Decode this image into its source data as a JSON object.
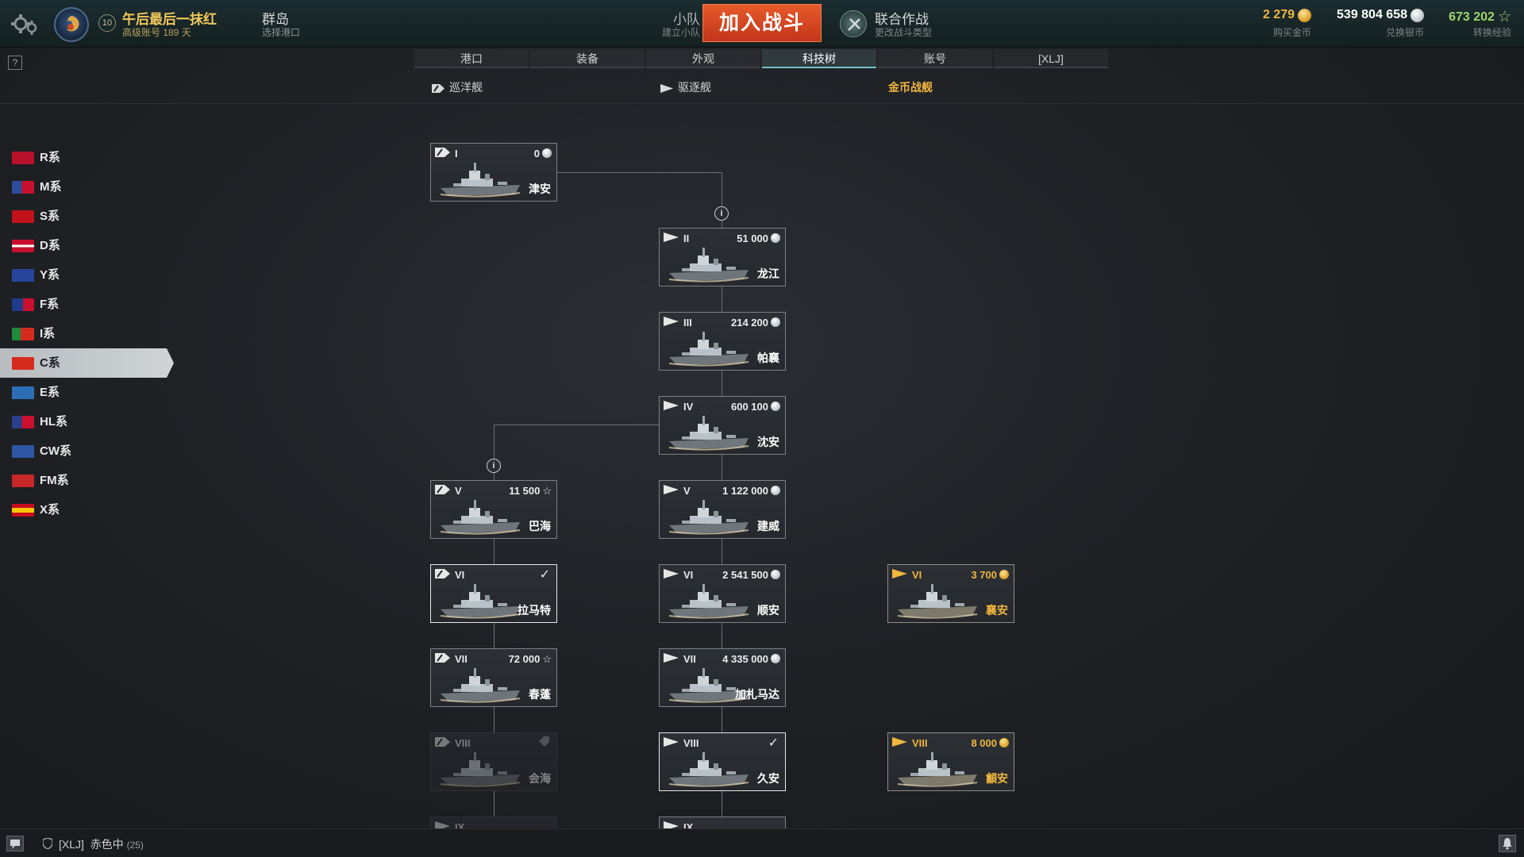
{
  "header": {
    "player_name": "午后最后一抹红",
    "player_sub": "高级账号 189 天",
    "level": "10",
    "port_name": "群岛",
    "port_sub": "选择港口",
    "division_label": "小队",
    "division_sub": "建立小队",
    "battle_button": "加入战斗",
    "mode_label": "联合作战",
    "mode_sub": "更改战斗类型",
    "currencies": [
      {
        "value": "2 279",
        "label": "购买金币",
        "icon": "gold-coin-icon",
        "color": "#f0b63e"
      },
      {
        "value": "539 804 658",
        "label": "兑换银币",
        "icon": "silver-coin-icon",
        "color": "#ffffff"
      },
      {
        "value": "673 202",
        "label": "转换经验",
        "icon": "free-xp-star-icon",
        "color": "#9ed66a"
      }
    ]
  },
  "tabs": [
    "港口",
    "装备",
    "外观",
    "科技树",
    "账号",
    "[XLJ]"
  ],
  "active_tab": "科技树",
  "help_label": "?",
  "subtabs": {
    "cruiser": "巡洋舰",
    "destroyer": "驱逐舰",
    "premium": "金币战舰"
  },
  "nations": [
    {
      "label": "R系",
      "flag": "#b8102a"
    },
    {
      "label": "M系",
      "flag": "#2f4d9e"
    },
    {
      "label": "S系",
      "flag": "#c1121c"
    },
    {
      "label": "D系",
      "flag": "#c8102e"
    },
    {
      "label": "Y系",
      "flag": "#26459a"
    },
    {
      "label": "F系",
      "flag": "#1f3b8a"
    },
    {
      "label": "I系",
      "flag": "#1e8a3c"
    },
    {
      "label": "C系",
      "flag": "#d52b1e",
      "active": true
    },
    {
      "label": "E系",
      "flag": "#2c6db5"
    },
    {
      "label": "HL系",
      "flag": "#2b3f8a"
    },
    {
      "label": "CW系",
      "flag": "#2e56a2"
    },
    {
      "label": "FM系",
      "flag": "#c62727"
    },
    {
      "label": "X系",
      "flag": "#c60b1e"
    }
  ],
  "ships": {
    "tsuan": {
      "tier": "I",
      "cost": "0",
      "cost_icon": "silver",
      "name": "津安",
      "class": "cruiser"
    },
    "longjiang": {
      "tier": "II",
      "cost": "51 000",
      "cost_icon": "silver",
      "name": "龙江",
      "class": "destroyer"
    },
    "phra": {
      "tier": "III",
      "cost": "214 200",
      "cost_icon": "silver",
      "name": "帕襄",
      "class": "destroyer"
    },
    "shenyang": {
      "tier": "IV",
      "cost": "600 100",
      "cost_icon": "silver",
      "name": "沈安",
      "class": "destroyer"
    },
    "bahai": {
      "tier": "V",
      "cost": "11 500",
      "cost_icon": "xp",
      "name": "巴海",
      "class": "cruiser"
    },
    "jianwei": {
      "tier": "V",
      "cost": "1 122 000",
      "cost_icon": "silver",
      "name": "建威",
      "class": "destroyer"
    },
    "lamate": {
      "tier": "VI",
      "cost": "",
      "cost_icon": "check",
      "name": "拉马特",
      "class": "cruiser"
    },
    "shunan": {
      "tier": "VI",
      "cost": "2 541 500",
      "cost_icon": "silver",
      "name": "顺安",
      "class": "destroyer"
    },
    "xiangan": {
      "tier": "VI",
      "cost": "3 700",
      "cost_icon": "gold",
      "name": "襄安",
      "class": "destroyer"
    },
    "chunlian": {
      "tier": "VII",
      "cost": "72 000",
      "cost_icon": "xp",
      "name": "春蓬",
      "class": "cruiser"
    },
    "gallimada": {
      "tier": "VII",
      "cost": "4 335 000",
      "cost_icon": "silver",
      "name": "加札马达",
      "class": "destroyer"
    },
    "huihai": {
      "tier": "VIII",
      "cost": "",
      "cost_icon": "elite",
      "name": "会海",
      "class": "cruiser"
    },
    "jiuan": {
      "tier": "VIII",
      "cost": "",
      "cost_icon": "check",
      "name": "久安",
      "class": "destroyer"
    },
    "guian": {
      "tier": "VIII",
      "cost": "8 000",
      "cost_icon": "gold",
      "name": "龥安",
      "class": "destroyer"
    },
    "nextcr": {
      "tier": "IX",
      "name": ""
    },
    "nextdd": {
      "tier": "IX",
      "name": ""
    }
  },
  "bottom": {
    "clan_tag": "[XLJ]",
    "clan_name": "赤色中",
    "clan_count": "(25)"
  }
}
